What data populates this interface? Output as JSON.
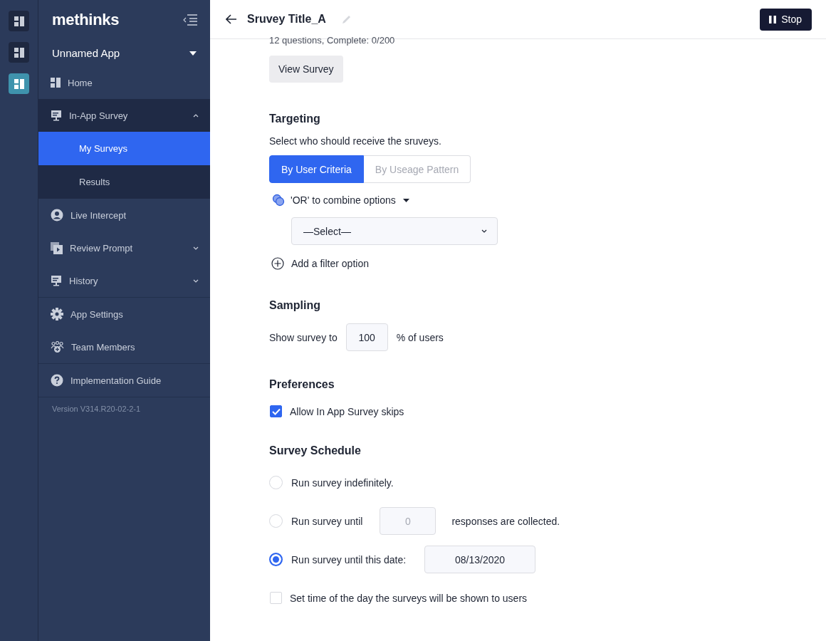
{
  "rail": {
    "items": [
      {
        "selected": false
      },
      {
        "selected": false
      },
      {
        "selected": true
      }
    ]
  },
  "sidebar": {
    "logo": "methinks",
    "app_selector": {
      "label": "Unnamed App"
    },
    "sections": [
      {
        "items": [
          {
            "label": "Home",
            "selected": false
          },
          {
            "label": "In-App Survey",
            "selected": false,
            "expanded": true,
            "children": [
              {
                "label": "My Surveys",
                "selected": true
              },
              {
                "label": "Results",
                "selected": false
              }
            ]
          },
          {
            "label": "Live Intercept",
            "selected": false
          },
          {
            "label": "Review Prompt",
            "selected": false,
            "expanded": false
          },
          {
            "label": "History",
            "selected": false,
            "expanded": false
          }
        ]
      },
      {
        "items": [
          {
            "label": "App Settings",
            "selected": false
          },
          {
            "label": "Team Members",
            "selected": false
          }
        ]
      },
      {
        "items": [
          {
            "label": "Implementation Guide",
            "selected": false
          }
        ]
      }
    ],
    "version": "Version V314.R20-02-2-1"
  },
  "header": {
    "title": "Sruvey Title_A",
    "stop_button": "Stop"
  },
  "summary": "12 questions, Complete: 0/200",
  "view_button": "View Survey",
  "targeting": {
    "heading": "Targeting",
    "description": "Select who should receive the sruveys.",
    "tabs": [
      {
        "label": "By User Criteria",
        "selected": true
      },
      {
        "label": "By Useage Pattern",
        "selected": false
      }
    ],
    "combine": "'OR' to combine options",
    "select": {
      "value": "—Select—"
    },
    "add_filter": "Add a filter option"
  },
  "sampling": {
    "heading": "Sampling",
    "prefix": "Show survey to",
    "value": "100",
    "suffix": "% of users"
  },
  "preferences": {
    "heading": "Preferences",
    "options": [
      {
        "label": "Allow In App Survey skips",
        "checked": true
      }
    ]
  },
  "schedule": {
    "heading": "Survey Schedule",
    "options": [
      {
        "kind": "plain",
        "label": "Run survey indefinitely.",
        "selected": false
      },
      {
        "kind": "count",
        "label": "Run survey until",
        "placeholder": "0",
        "suffix": "responses are collected.",
        "selected": false
      },
      {
        "kind": "date",
        "label": "Run survey until this date:",
        "value": "08/13/2020",
        "selected": true
      }
    ],
    "time_option": {
      "label": "Set time of the day the surveys will be shown to users",
      "checked": false
    }
  }
}
